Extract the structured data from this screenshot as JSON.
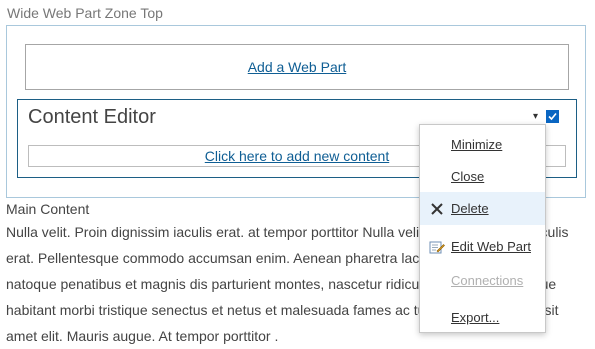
{
  "zone": {
    "label": "Wide Web Part Zone Top",
    "add_web_part_label": "Add a Web Part"
  },
  "webpart": {
    "title": "Content Editor",
    "menu_arrow": "▾",
    "add_content_label": "Click here to add new content",
    "checkbox_checked": true
  },
  "main": {
    "title": "Main Content",
    "body": "Nulla velit. Proin dignissim iaculis erat. at tempor porttitor Nulla velit. Proin dignissim iaculis erat. Pellentesque commodo accumsan enim. Aenean pharetra lacinia nisi. Cum sociis natoque penatibus et magnis dis parturient montes, nascetur ridiculus mus. Pellentesque habitant morbi tristique senectus et netus et malesuada fames ac turpis egestas. Nulla sit amet elit. Mauris augue.  At tempor porttitor ."
  },
  "menu": {
    "items": [
      {
        "label": "Minimize",
        "icon": "",
        "state": "normal"
      },
      {
        "label": "Close",
        "icon": "",
        "state": "normal"
      },
      {
        "label": "Delete",
        "icon": "delete-icon",
        "state": "hover"
      },
      {
        "label": "Edit Web Part",
        "icon": "edit-icon",
        "state": "normal"
      },
      {
        "label": "Connections",
        "icon": "",
        "state": "disabled"
      },
      {
        "label": "Export...",
        "icon": "",
        "state": "normal"
      }
    ]
  },
  "colors": {
    "link": "#0f5e94",
    "zone_border": "#a9c8dc",
    "webpart_border": "#1c5e85",
    "menu_hover": "#e8f2fb"
  }
}
